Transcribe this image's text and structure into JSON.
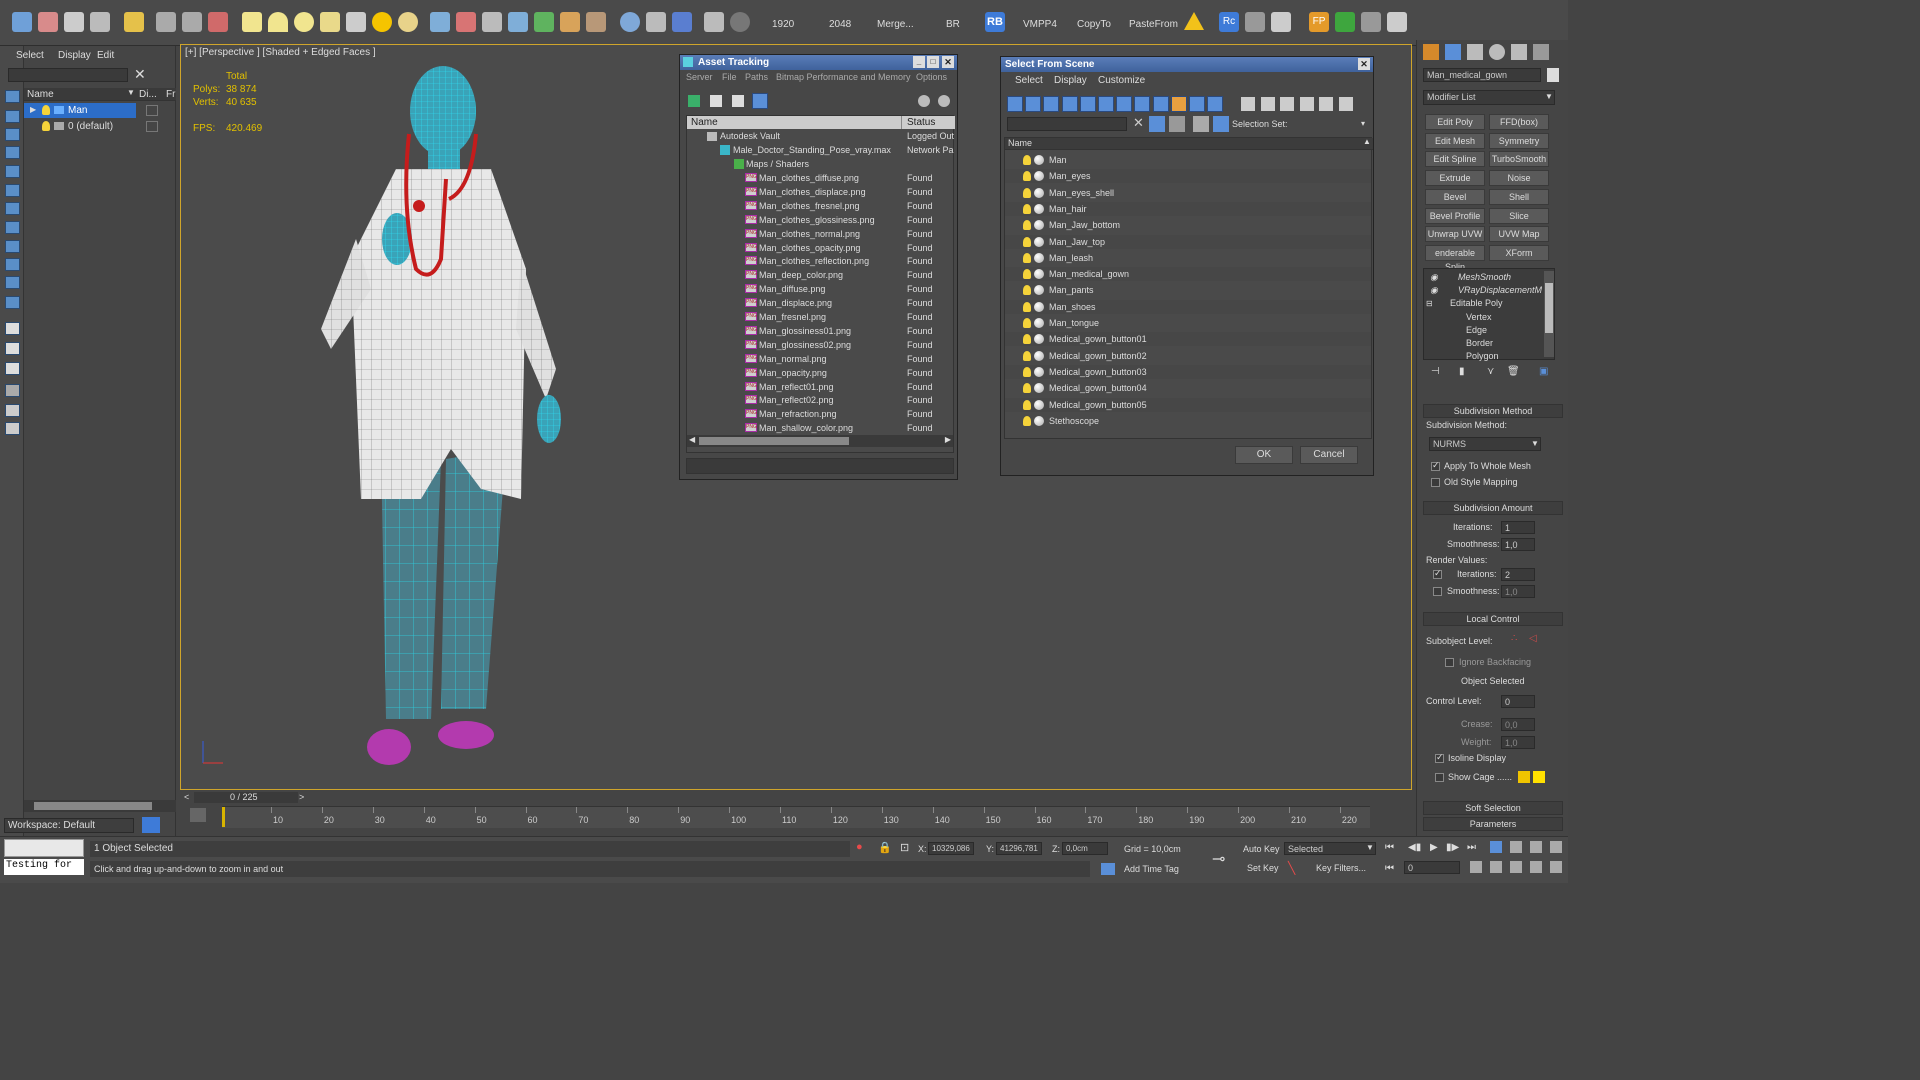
{
  "toolbar": {
    "labels": [
      "1920",
      "2048",
      "Merge...",
      "BR",
      "VMPP4",
      "CopyTo",
      "PasteFrom"
    ],
    "rb_label": "RB",
    "rc_label": "Rc",
    "fp_label": "FP"
  },
  "explorer": {
    "menu": [
      "Select",
      "Display",
      "Edit"
    ],
    "col_name": "Name",
    "col_di": "Di...",
    "col_fr": "Fr",
    "items": [
      {
        "label": "Man"
      },
      {
        "label": "0 (default)"
      }
    ],
    "workspace": "Workspace: Default"
  },
  "viewport": {
    "label": "[+] [Perspective ] [Shaded + Edged Faces ]",
    "stats": {
      "total": "Total",
      "polys_label": "Polys:",
      "polys": "38 874",
      "verts_label": "Verts:",
      "verts": "40 635",
      "fps_label": "FPS:",
      "fps": "420.469"
    }
  },
  "asset_tracking": {
    "title": "Asset Tracking",
    "menu": [
      "Server",
      "File",
      "Paths",
      "Bitmap Performance and Memory",
      "Options"
    ],
    "col_name": "Name",
    "col_status": "Status",
    "vault": {
      "name": "Autodesk Vault",
      "status": "Logged Out"
    },
    "file": {
      "name": "Male_Doctor_Standing_Pose_vray.max",
      "status": "Network Pa"
    },
    "group": "Maps / Shaders",
    "png_tag": "PNG",
    "assets": [
      {
        "name": "Man_clothes_diffuse.png",
        "status": "Found"
      },
      {
        "name": "Man_clothes_displace.png",
        "status": "Found"
      },
      {
        "name": "Man_clothes_fresnel.png",
        "status": "Found"
      },
      {
        "name": "Man_clothes_glossiness.png",
        "status": "Found"
      },
      {
        "name": "Man_clothes_normal.png",
        "status": "Found"
      },
      {
        "name": "Man_clothes_opacity.png",
        "status": "Found"
      },
      {
        "name": "Man_clothes_reflection.png",
        "status": "Found"
      },
      {
        "name": "Man_deep_color.png",
        "status": "Found"
      },
      {
        "name": "Man_diffuse.png",
        "status": "Found"
      },
      {
        "name": "Man_displace.png",
        "status": "Found"
      },
      {
        "name": "Man_fresnel.png",
        "status": "Found"
      },
      {
        "name": "Man_glossiness01.png",
        "status": "Found"
      },
      {
        "name": "Man_glossiness02.png",
        "status": "Found"
      },
      {
        "name": "Man_normal.png",
        "status": "Found"
      },
      {
        "name": "Man_opacity.png",
        "status": "Found"
      },
      {
        "name": "Man_reflect01.png",
        "status": "Found"
      },
      {
        "name": "Man_reflect02.png",
        "status": "Found"
      },
      {
        "name": "Man_refraction.png",
        "status": "Found"
      },
      {
        "name": "Man_shallow_color.png",
        "status": "Found"
      }
    ]
  },
  "select_from_scene": {
    "title": "Select From Scene",
    "menu": [
      "Select",
      "Display",
      "Customize"
    ],
    "selection_set": "Selection Set:",
    "col_name": "Name",
    "objects": [
      "Man",
      "Man_eyes",
      "Man_eyes_shell",
      "Man_hair",
      "Man_Jaw_bottom",
      "Man_Jaw_top",
      "Man_leash",
      "Man_medical_gown",
      "Man_pants",
      "Man_shoes",
      "Man_tongue",
      "Medical_gown_button01",
      "Medical_gown_button02",
      "Medical_gown_button03",
      "Medical_gown_button04",
      "Medical_gown_button05",
      "Stethoscope"
    ],
    "ok": "OK",
    "cancel": "Cancel"
  },
  "command_panel": {
    "object_name": "Man_medical_gown",
    "modifier_list": "Modifier List",
    "buttons": [
      "Edit Poly",
      "FFD(box)",
      "Edit Mesh",
      "Symmetry",
      "Edit Spline",
      "TurboSmooth",
      "Extrude",
      "Noise",
      "Bevel",
      "Shell",
      "Bevel Profile",
      "Slice",
      "Unwrap UVW",
      "UVW Map",
      "enderable Splin",
      "XForm"
    ],
    "stack": [
      "MeshSmooth",
      "VRayDisplacementM",
      "Editable Poly",
      "Vertex",
      "Edge",
      "Border",
      "Polygon"
    ],
    "subdivision_method": {
      "title": "Subdivision Method",
      "label": "Subdivision Method:",
      "value": "NURMS",
      "apply_whole": "Apply To Whole Mesh",
      "old_style": "Old Style Mapping"
    },
    "subdivision_amount": {
      "title": "Subdivision Amount",
      "iterations_label": "Iterations:",
      "iterations": "1",
      "smoothness_label": "Smoothness:",
      "smoothness": "1,0",
      "render_values": "Render Values:",
      "r_iterations": "2",
      "r_smoothness": "1,0"
    },
    "local_control": {
      "title": "Local Control",
      "subobject": "Subobject Level:",
      "ignore_backfacing": "Ignore Backfacing",
      "object_selected": "Object Selected",
      "control_level_label": "Control Level:",
      "control_level": "0",
      "crease_label": "Crease:",
      "crease": "0,0",
      "weight_label": "Weight:",
      "weight": "1,0",
      "isoline": "Isoline Display",
      "show_cage": "Show Cage ......"
    },
    "soft_selection": "Soft Selection",
    "parameters": "Parameters"
  },
  "timeline": {
    "frame": "0 / 225",
    "ticks": [
      "10",
      "20",
      "30",
      "40",
      "50",
      "60",
      "70",
      "80",
      "90",
      "100",
      "110",
      "120",
      "130",
      "140",
      "150",
      "160",
      "170",
      "180",
      "190",
      "200",
      "210",
      "220"
    ]
  },
  "status": {
    "objects_selected": "1 Object Selected",
    "hint": "Click and drag up-and-down to zoom in and out",
    "script": "Testing for",
    "x_label": "X:",
    "x": "10329,086",
    "y_label": "Y:",
    "y": "41296,781",
    "z_label": "Z:",
    "z": "0,0cm",
    "grid": "Grid = 10,0cm",
    "auto_key": "Auto Key",
    "selected": "Selected",
    "set_key": "Set Key",
    "key_filters": "Key Filters...",
    "add_time_tag": "Add Time Tag",
    "frame_field": "0"
  }
}
